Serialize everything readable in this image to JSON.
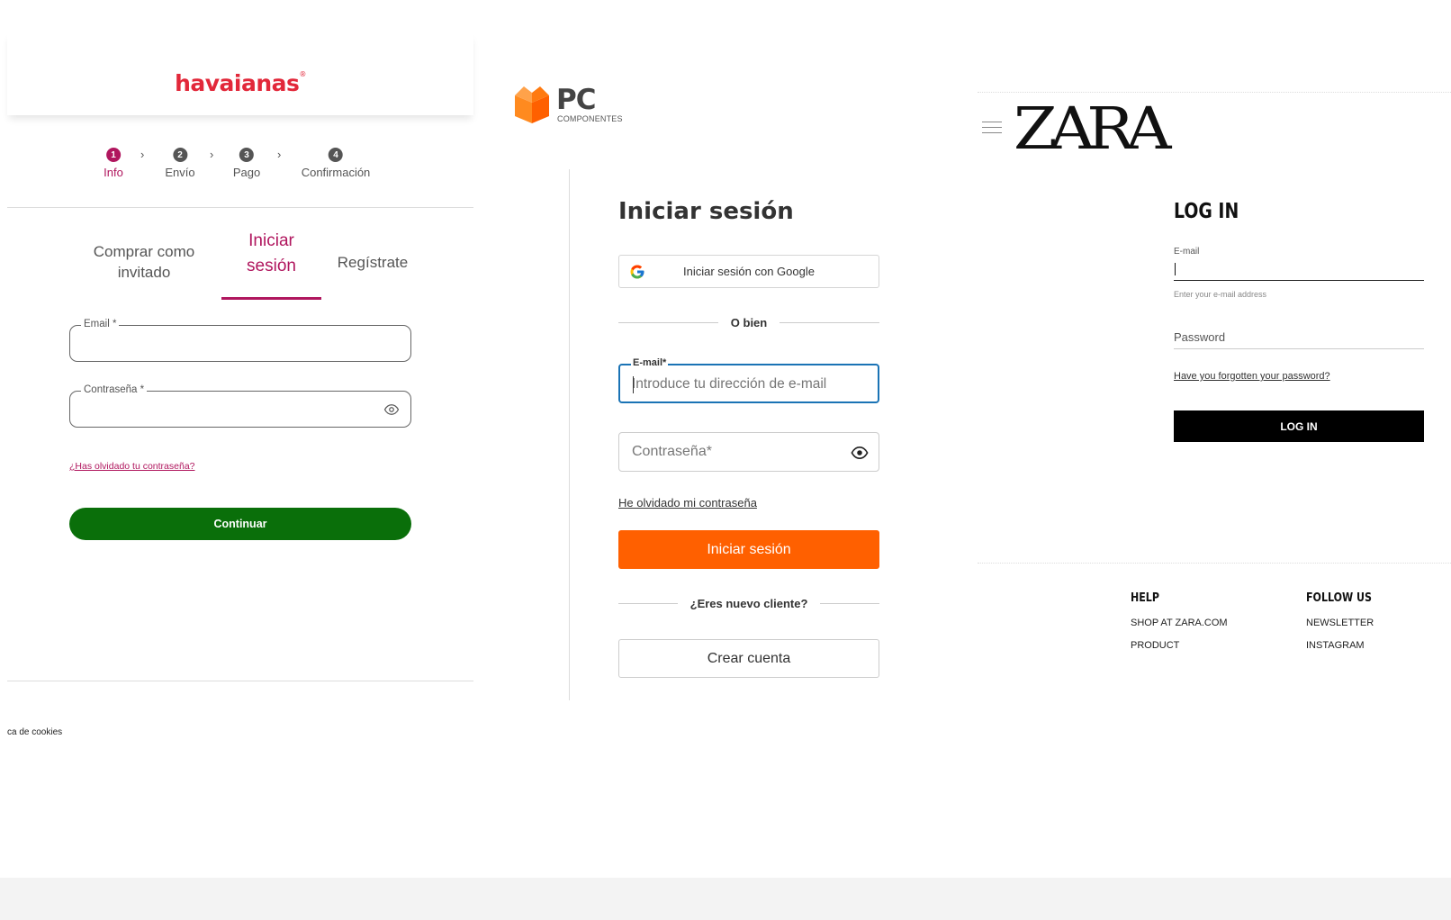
{
  "havaianas": {
    "logo": "havaianas",
    "logo_mark": "®",
    "steps": [
      {
        "num": "1",
        "label": "Info"
      },
      {
        "num": "2",
        "label": "Envío"
      },
      {
        "num": "3",
        "label": "Pago"
      },
      {
        "num": "4",
        "label": "Confirmación"
      }
    ],
    "step_separator": "›",
    "tabs": {
      "guest_line1": "Comprar como",
      "guest_line2": "invitado",
      "login_line1": "Iniciar",
      "login_line2": "sesión",
      "register": "Regístrate"
    },
    "email_label": "Email *",
    "password_label": "Contraseña *",
    "forgot": "¿Has olvidado tu contraseña?",
    "continue": "Continuar",
    "cookies": "ca de cookies",
    "colors": {
      "brand": "#e2283a",
      "accent": "#b0165e",
      "button": "#0a6f0a"
    }
  },
  "pccomponentes": {
    "logo_main": "PC",
    "logo_sub": "COMPONENTES",
    "title": "Iniciar sesión",
    "google": "Iniciar sesión con Google",
    "or": "O bien",
    "email_label": "E-mail*",
    "email_placeholder": "Introduce tu dirección de e-mail",
    "password_placeholder": "Contraseña*",
    "forgot": "He olvidado mi contraseña",
    "submit": "Iniciar sesión",
    "new_customer": "¿Eres nuevo cliente?",
    "create": "Crear cuenta",
    "colors": {
      "accent": "#ff6000",
      "focus": "#1a73b5"
    }
  },
  "zara": {
    "logo": "ZARA",
    "title": "LOG IN",
    "email_label": "E-mail",
    "email_hint": "Enter your e-mail address",
    "password_label": "Password",
    "forgot": "Have you forgotten your password?",
    "submit": "LOG IN",
    "footer": {
      "help_title": "HELP",
      "help_items": [
        "SHOP AT ZARA.COM",
        "PRODUCT"
      ],
      "follow_title": "FOLLOW US",
      "follow_items": [
        "NEWSLETTER",
        "INSTAGRAM"
      ]
    }
  }
}
